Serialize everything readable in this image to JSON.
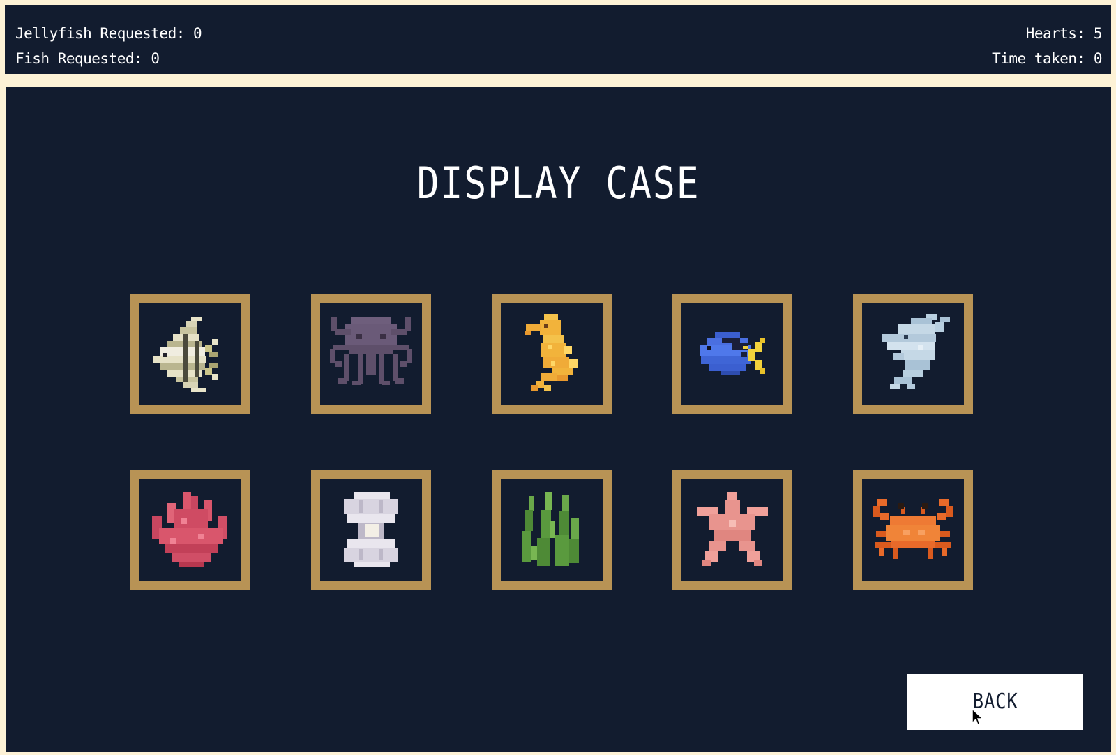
{
  "hud": {
    "jellyfish_label": "Jellyfish Requested:",
    "jellyfish_value": "0",
    "fish_label": "Fish Requested:",
    "fish_value": "0",
    "hearts_label": "Hearts:",
    "hearts_value": "5",
    "time_label": "Time taken:",
    "time_value": "0"
  },
  "title": "DISPLAY CASE",
  "back_label": "BACK",
  "colors": {
    "background": "#121c2f",
    "frame": "#b89355",
    "border": "#fdf2d6",
    "text": "#ffffff"
  },
  "display_items": [
    {
      "icon": "angelfish-icon"
    },
    {
      "icon": "octopus-icon"
    },
    {
      "icon": "seahorse-icon"
    },
    {
      "icon": "blue-tang-icon"
    },
    {
      "icon": "dolphin-icon"
    },
    {
      "icon": "coral-icon"
    },
    {
      "icon": "clam-pearl-icon"
    },
    {
      "icon": "seaweed-icon"
    },
    {
      "icon": "starfish-icon"
    },
    {
      "icon": "crab-icon"
    }
  ]
}
